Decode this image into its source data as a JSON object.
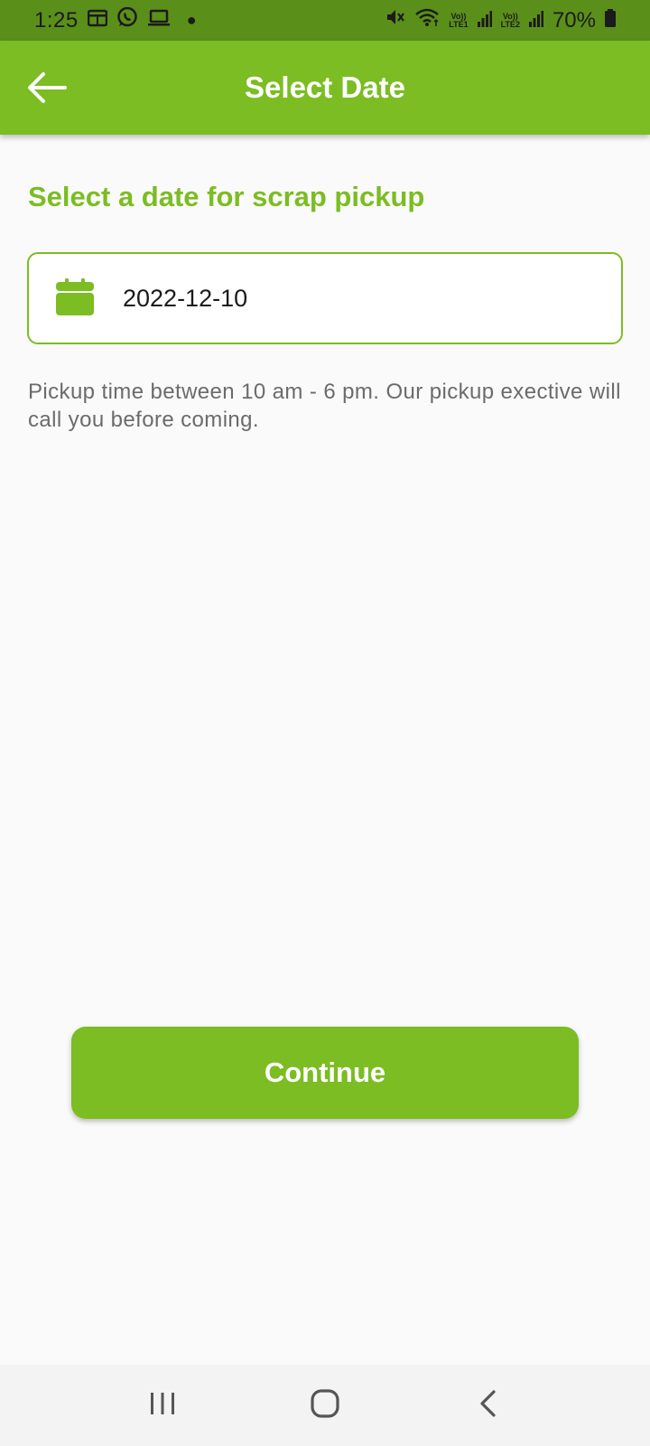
{
  "status_bar": {
    "time": "1:25",
    "net1_top": "Vo))",
    "net1_bottom": "LTE1",
    "net2_top": "Vo))",
    "net2_bottom": "LTE2",
    "battery": "70%",
    "icons": [
      "calendar-icon",
      "whatsapp-icon",
      "laptop-icon",
      "mute-icon",
      "wifi-icon",
      "signal-icon",
      "battery-icon"
    ]
  },
  "app_bar": {
    "title": "Select Date",
    "back_icon": "arrow-left-icon"
  },
  "main": {
    "section_title": "Select a date for scrap pickup",
    "date_value": "2022-12-10",
    "date_icon": "calendar-icon",
    "helper_text": "Pickup time between 10 am - 6 pm. Our pickup exective will call you before coming.",
    "continue_label": "Continue"
  },
  "nav_bar": {
    "icons": [
      "recent-apps-icon",
      "home-icon",
      "back-icon"
    ]
  },
  "colors": {
    "primary": "#7bbd22",
    "status_bar": "#5a8f1a",
    "background": "#fafafa",
    "helper_text": "#6b6b6b"
  }
}
